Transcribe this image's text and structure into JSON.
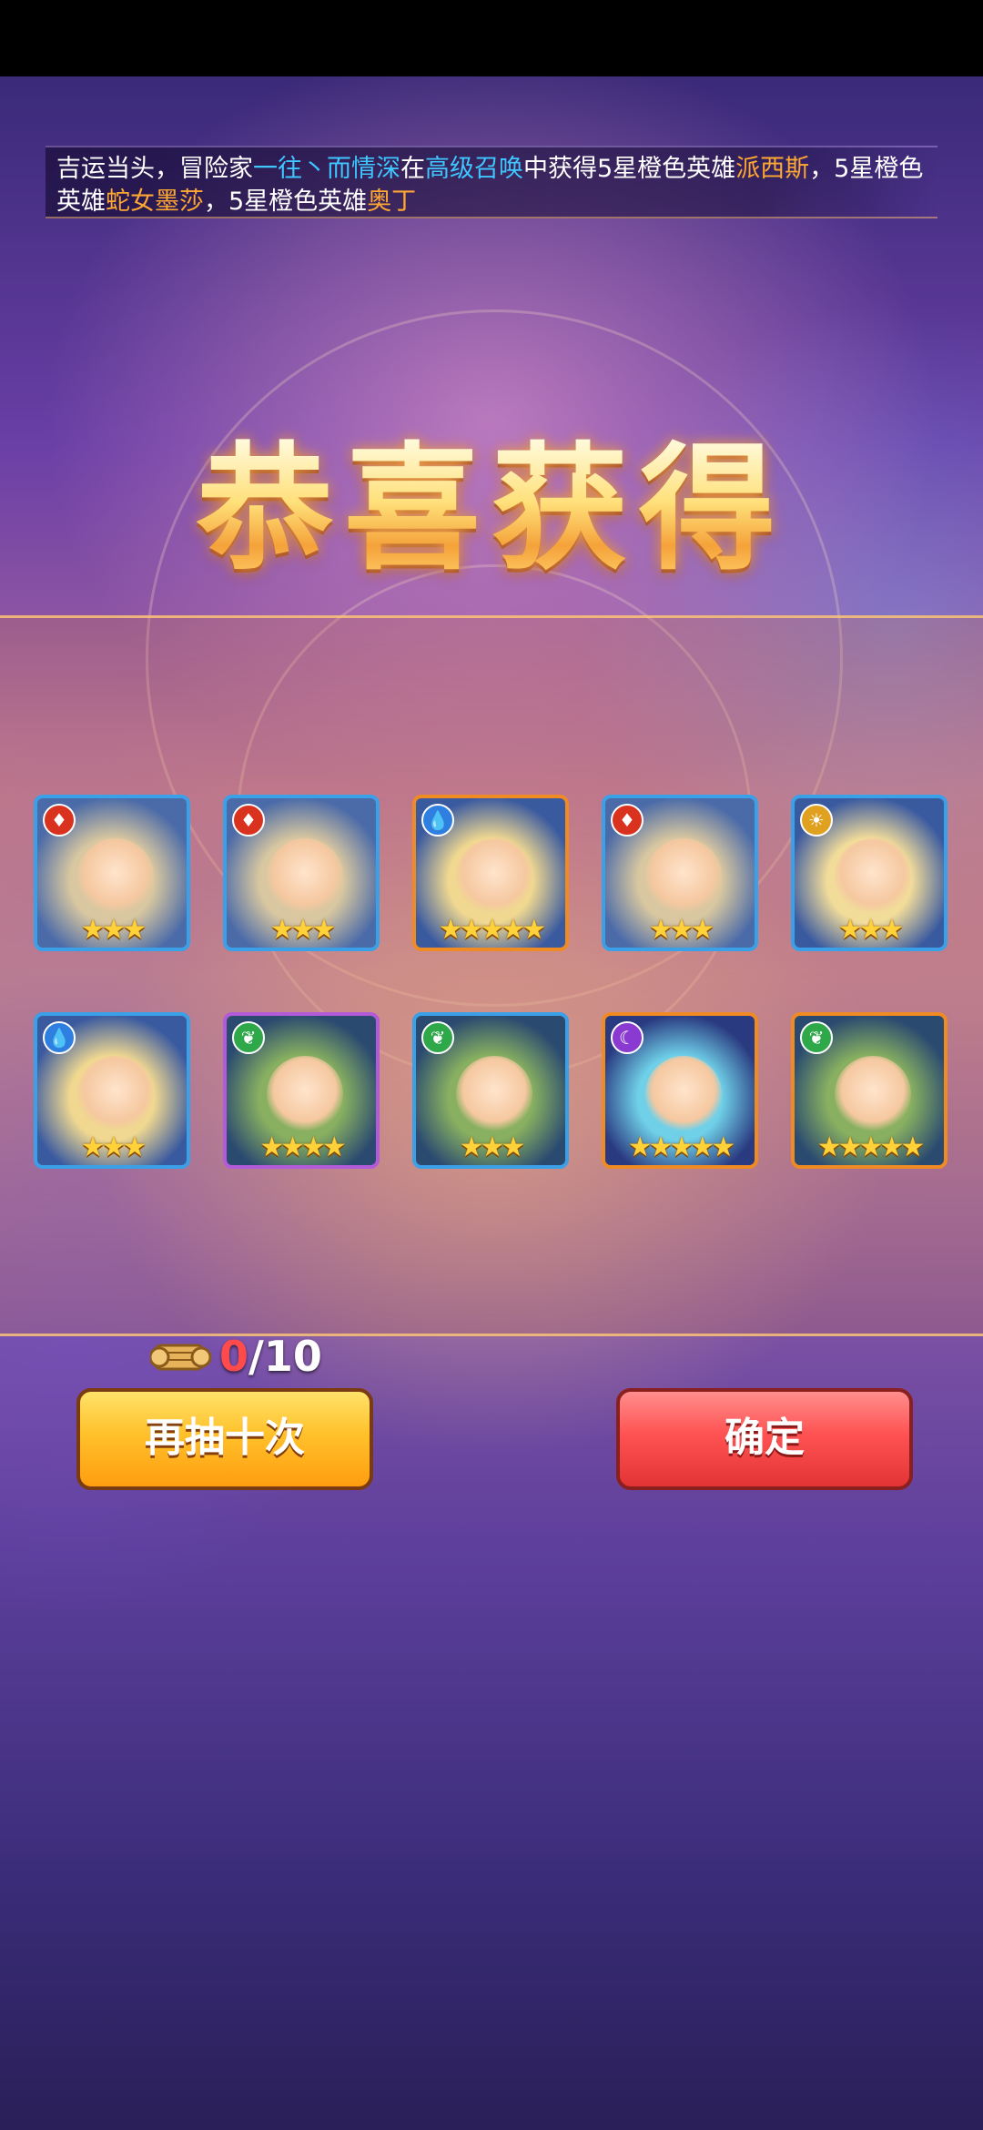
{
  "ticker": {
    "p1": "吉运当头，冒险家",
    "player": "一往丶而情深",
    "p2": "在",
    "summon": "高级召唤",
    "p3": "中获得5星橙色英雄",
    "hero1": "派西斯",
    "p4": "，5星橙色英雄",
    "hero2": "蛇女墨莎",
    "p5": "，5星橙色英雄",
    "hero3": "奥丁"
  },
  "title": "恭喜获得",
  "rewards": [
    {
      "element": "fire",
      "element_icon": "♦",
      "stars": "★★★",
      "rarity": "blue"
    },
    {
      "element": "fire",
      "element_icon": "♦",
      "stars": "★★★",
      "rarity": "blue"
    },
    {
      "element": "water",
      "element_icon": "💧",
      "stars": "★★★★★",
      "rarity": "orange"
    },
    {
      "element": "fire",
      "element_icon": "♦",
      "stars": "★★★",
      "rarity": "blue"
    },
    {
      "element": "light",
      "element_icon": "☀",
      "stars": "★★★",
      "rarity": "blue"
    },
    {
      "element": "water",
      "element_icon": "💧",
      "stars": "★★★",
      "rarity": "blue"
    },
    {
      "element": "nature",
      "element_icon": "❦",
      "stars": "★★★★",
      "rarity": "purple"
    },
    {
      "element": "nature",
      "element_icon": "❦",
      "stars": "★★★",
      "rarity": "blue"
    },
    {
      "element": "dark",
      "element_icon": "☾",
      "stars": "★★★★★",
      "rarity": "orange"
    },
    {
      "element": "nature",
      "element_icon": "❦",
      "stars": "★★★★★",
      "rarity": "orange"
    }
  ],
  "counter": {
    "current": "0",
    "total": "/10"
  },
  "buttons": {
    "again": "再抽十次",
    "confirm": "确定"
  },
  "colors": {
    "accent_blue": "#3fc6ff",
    "accent_orange": "#ffa733",
    "frame_blue": "#3aa0e8",
    "frame_orange": "#f08a22",
    "frame_purple": "#b25ad8"
  }
}
